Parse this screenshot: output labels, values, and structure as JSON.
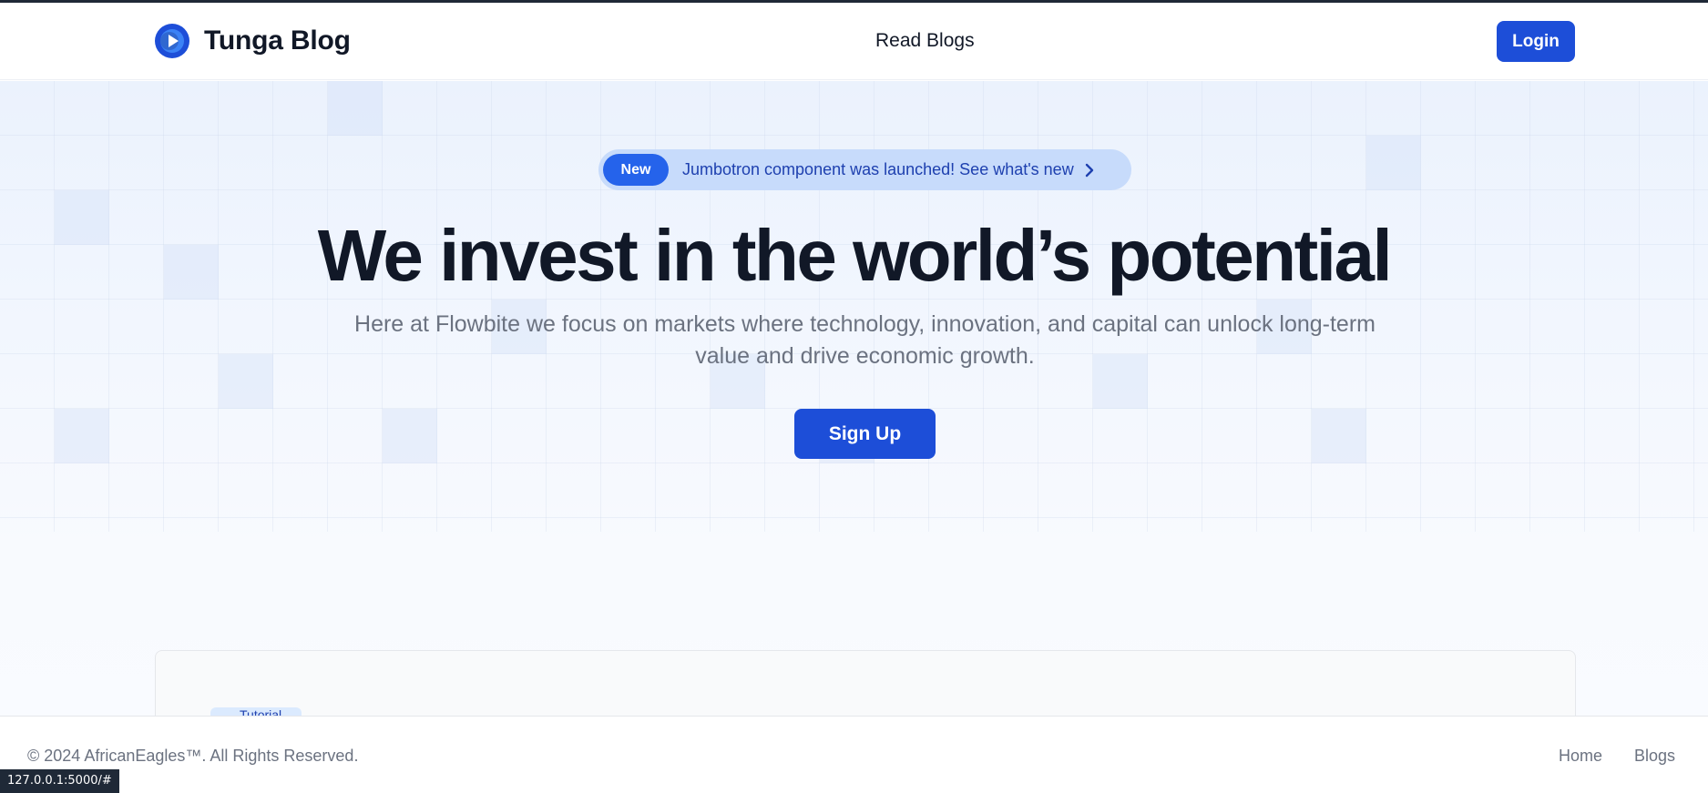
{
  "navbar": {
    "brand_name": "Tunga Blog",
    "nav_links": [
      "Read Blogs"
    ],
    "login_label": "Login",
    "brand_color": "#1d4ed8"
  },
  "hero": {
    "announcement": {
      "badge": "New",
      "text": "Jumbotron component was launched! See what's new",
      "icon": "chevron-right-icon"
    },
    "title": "We invest in the world’s potential",
    "subtitle": "Here at Flowbite we focus on markets where technology, innovation, and capital can unlock long-term value and drive economic growth.",
    "cta_label": "Sign Up"
  },
  "card": {
    "chip_text": "Tutorial"
  },
  "footer": {
    "copyright": "© 2024 AfricanEagles™. All Rights Reserved.",
    "links": [
      "Home",
      "Blogs"
    ]
  },
  "status_bar": {
    "url": "127.0.0.1:5000/#"
  },
  "colors": {
    "accent": "#1d4ed8",
    "badge": "#2563eb",
    "announce_bg": "#c7dbfb",
    "text_dark": "#111827",
    "text_muted": "#6b7280"
  }
}
